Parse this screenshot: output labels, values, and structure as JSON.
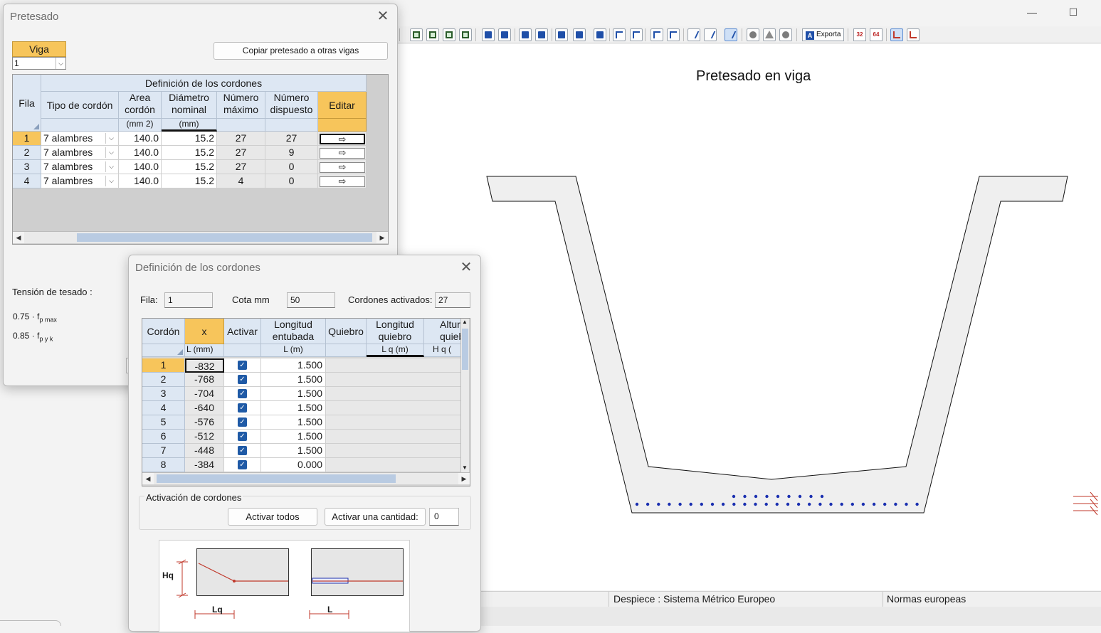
{
  "main_window": {
    "title": "Pretesado en viga",
    "status_left": "Despiece : Sistema Métrico Europeo",
    "status_right": "Normas europeas",
    "toolbar_export_label": "Exporta",
    "toolbar_num_32": "32",
    "toolbar_num_64": "64",
    "minimize_glyph": "—",
    "maximize_glyph": "☐"
  },
  "pretesado_dialog": {
    "title": "Pretesado",
    "viga_label": "Viga",
    "viga_value": "1",
    "copy_button": "Copiar pretesado a otras vigas",
    "grid": {
      "group_header": "Definición de  los cordones",
      "col_fila": "Fila",
      "col_tipo": "Tipo de cordón",
      "col_area_1": "Area",
      "col_area_2": "cordón",
      "col_area_unit": "(mm 2)",
      "col_diam_1": "Diámetro",
      "col_diam_2": "nominal",
      "col_diam_unit": "(mm)",
      "col_nmax_1": "Número",
      "col_nmax_2": "máximo",
      "col_ndisp_1": "Número",
      "col_ndisp_2": "dispuesto",
      "col_editar": "Editar",
      "edit_glyph": "⇨",
      "rows": [
        {
          "fila": "1",
          "tipo": "7 alambres",
          "area": "140.0",
          "diametro": "15.2",
          "nmax": "27",
          "ndisp": "27"
        },
        {
          "fila": "2",
          "tipo": "7 alambres",
          "area": "140.0",
          "diametro": "15.2",
          "nmax": "27",
          "ndisp": "9"
        },
        {
          "fila": "3",
          "tipo": "7 alambres",
          "area": "140.0",
          "diametro": "15.2",
          "nmax": "27",
          "ndisp": "0"
        },
        {
          "fila": "4",
          "tipo": "7 alambres",
          "area": "140.0",
          "diametro": "15.2",
          "nmax": "4",
          "ndisp": "0"
        }
      ]
    },
    "tension_label": "Tensión de tesado :",
    "tension_1_coef": "0.75 · f",
    "tension_1_sub": "p max",
    "tension_2_coef": "0.85 · f",
    "tension_2_sub": "p y k"
  },
  "definicion_dialog": {
    "title": "Definición de los cordones",
    "fila_label": "Fila:",
    "fila_value": "1",
    "cota_label": "Cota  mm",
    "cota_value": "50",
    "activados_label": "Cordones activados:",
    "activados_value": "27",
    "grid": {
      "col_cordon": "Cordón",
      "col_x": "x",
      "col_x_unit": "L    (mm)",
      "col_activar": "Activar",
      "col_long_1": "Longitud",
      "col_long_2": "entubada",
      "col_long_unit": "L    (m)",
      "col_quiebro": "Quiebro",
      "col_lq_1": "Longitud",
      "col_lq_2": "quiebro",
      "col_lq_unit": "L q    (m)",
      "col_alt_1": "Altura",
      "col_alt_2": "quiebro",
      "col_alt_unit": "H q    (",
      "rows": [
        {
          "cordon": "1",
          "x": "-832",
          "activar": true,
          "longitud": "1.500"
        },
        {
          "cordon": "2",
          "x": "-768",
          "activar": true,
          "longitud": "1.500"
        },
        {
          "cordon": "3",
          "x": "-704",
          "activar": true,
          "longitud": "1.500"
        },
        {
          "cordon": "4",
          "x": "-640",
          "activar": true,
          "longitud": "1.500"
        },
        {
          "cordon": "5",
          "x": "-576",
          "activar": true,
          "longitud": "1.500"
        },
        {
          "cordon": "6",
          "x": "-512",
          "activar": true,
          "longitud": "1.500"
        },
        {
          "cordon": "7",
          "x": "-448",
          "activar": true,
          "longitud": "1.500"
        },
        {
          "cordon": "8",
          "x": "-384",
          "activar": true,
          "longitud": "0.000"
        }
      ]
    },
    "activation_group": "Activación de cordones",
    "activate_all_button": "Activar todos",
    "activate_qty_button": "Activar una cantidad:",
    "activate_qty_value": "0",
    "diagram": {
      "hq_label": "Hq",
      "lq_label": "Lq",
      "l_label": "L"
    }
  },
  "colors": {
    "accent_orange": "#f7c55b",
    "header_blue": "#dde7f3",
    "strand_blue": "#1a2fb0",
    "section_fill": "#efefef"
  }
}
